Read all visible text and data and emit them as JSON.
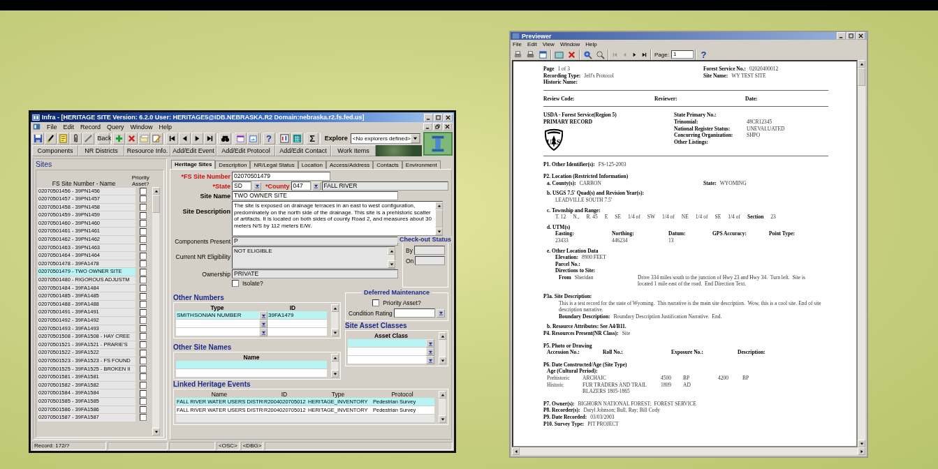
{
  "infra_window": {
    "title": "Infra - [HERITAGE SITE  Version: 6.2.0  User: HERITAGE5@IDB.NEBRASKA.R2  Domain:nebraska.r2.fs.fed.us]",
    "menu": [
      "File",
      "Edit",
      "Record",
      "Query",
      "Window",
      "Help"
    ],
    "toolbar": {
      "back": "Back",
      "help_glyph": "?",
      "sum_glyph": "Σ",
      "explore_label": "Explore",
      "explore_value": "<No explorers defined>"
    },
    "buttons": [
      "Components",
      "NR Districts",
      "Resource Info.",
      "Add/Edit Event",
      "Add/Edit Protocol",
      "Add/Edit Contact",
      "Work Items"
    ],
    "sites": {
      "title": "Sites",
      "columns": [
        "FS Site Number - Name",
        "Priority Asset?"
      ],
      "rows": [
        {
          "label": "02070501456 - 39PN1456",
          "priority": false,
          "selected": false
        },
        {
          "label": "02070501457 - 39PN1457",
          "priority": false,
          "selected": false
        },
        {
          "label": "02070501458 - 39PN1458",
          "priority": false,
          "selected": false
        },
        {
          "label": "02070501459 - 39PN1459",
          "priority": false,
          "selected": false
        },
        {
          "label": "02070501460 - 39PN1460",
          "priority": false,
          "selected": false
        },
        {
          "label": "02070501461 - 39PN1461",
          "priority": false,
          "selected": false
        },
        {
          "label": "02070501462 - 39PN1462",
          "priority": false,
          "selected": false
        },
        {
          "label": "02070501463 - 39PN1463",
          "priority": false,
          "selected": false
        },
        {
          "label": "02070501464 - 39PN1464",
          "priority": false,
          "selected": false
        },
        {
          "label": "02070501478 - 39FA1478",
          "priority": false,
          "selected": false
        },
        {
          "label": "02070501479 - TWO OWNER SITE",
          "priority": false,
          "selected": true
        },
        {
          "label": "02070501480 - RIGOROUS ADJUSTM",
          "priority": false,
          "selected": false
        },
        {
          "label": "02070501484 - 39FA1484",
          "priority": false,
          "selected": false
        },
        {
          "label": "02070501485 - 39FA1485",
          "priority": false,
          "selected": false
        },
        {
          "label": "02070501488 - 39FA1488",
          "priority": false,
          "selected": false
        },
        {
          "label": "02070501491 - 39FA1491",
          "priority": false,
          "selected": false
        },
        {
          "label": "02070501492 - 39FA1492",
          "priority": false,
          "selected": false
        },
        {
          "label": "02070501493 - 39FA1493",
          "priority": false,
          "selected": false
        },
        {
          "label": "02070501508 - 39FA1508 - HAY CREE",
          "priority": false,
          "selected": false
        },
        {
          "label": "02070501521 - 39FA1521 - PRARIE'S",
          "priority": false,
          "selected": false
        },
        {
          "label": "02070501522 - 39FA1522",
          "priority": false,
          "selected": false
        },
        {
          "label": "02070501523 - 39FA1523 - FS FOUND",
          "priority": false,
          "selected": false
        },
        {
          "label": "02070501525 - 39FA1525 - BROKEN II",
          "priority": false,
          "selected": false
        },
        {
          "label": "02070501581 - 39FA1581",
          "priority": false,
          "selected": false
        },
        {
          "label": "02070501582 - 39FA1582",
          "priority": false,
          "selected": false
        },
        {
          "label": "02070501584 - 39FA1584",
          "priority": false,
          "selected": false
        },
        {
          "label": "02070501585 - 39FA1585",
          "priority": false,
          "selected": false
        },
        {
          "label": "02070501586 - 39FA1586",
          "priority": false,
          "selected": false
        },
        {
          "label": "02070501587 - 39FA1587",
          "priority": false,
          "selected": false
        }
      ]
    },
    "tabs": [
      {
        "label": "Heritage Sites",
        "selected": true
      },
      {
        "label": "Description",
        "selected": false
      },
      {
        "label": "NR/Legal Status",
        "selected": false
      },
      {
        "label": "Location",
        "selected": false
      },
      {
        "label": "Access/Address",
        "selected": false
      },
      {
        "label": "Contacts",
        "selected": false
      },
      {
        "label": "Environment",
        "selected": false
      }
    ],
    "form": {
      "fs_site_number": {
        "label": "*FS Site Number",
        "value": "02070501479",
        "required": true,
        "key_field": true,
        "read_only": false
      },
      "state": {
        "label": "*State",
        "value": "SD",
        "required": true,
        "key_field": true,
        "read_only": false
      },
      "county": {
        "label": "*County",
        "value": "047",
        "required": true,
        "key_field": true,
        "read_only": false
      },
      "county_name": {
        "value": "FALL RIVER",
        "read_only": true
      },
      "site_name": {
        "label": "Site Name",
        "value": "TWO OWNER SITE",
        "required": false,
        "key_field": true,
        "read_only": false
      },
      "site_description": {
        "label": "Site Description",
        "value": "The site is exposed on drainage terraces in an east to west configuration, predominately on the north side of the drainage. This site is a prehistoric scatter of artifacts.  It is located on both sides of county Road 2, and measures about 30 meters N/S by 112 meters E/W.",
        "required": false,
        "key_field": true,
        "read_only": false
      },
      "components_present": {
        "label": "Components Present",
        "value": "P",
        "required": false,
        "key_field": false,
        "read_only": true
      },
      "current_nr_eligibility": {
        "label": "Current NR Eligibility",
        "value": "NOT ELIGIBLE",
        "required": false,
        "key_field": false,
        "read_only": true
      },
      "ownership": {
        "label": "Ownership",
        "value": "PRIVATE",
        "required": false,
        "key_field": false,
        "read_only": true
      },
      "isolate": {
        "label": "Isolate?",
        "checked": false
      }
    },
    "checkout_status": {
      "title": "Check-out Status",
      "fields": [
        "By",
        "On"
      ]
    },
    "deferred_maintenance": {
      "title": "Deferred Maintenance",
      "priority_asset": {
        "label": "Priority Asset?",
        "checked": false
      },
      "condition_rating": {
        "label": "Condition Rating"
      }
    },
    "other_numbers": {
      "title": "Other Numbers",
      "columns": [
        "Type",
        "ID"
      ],
      "rows": [
        {
          "type": "SMITHSONIAN NUMBER",
          "id": "39FA1479",
          "selected": true
        }
      ]
    },
    "site_asset_classes": {
      "title": "Site Asset Classes",
      "columns": [
        "Asset Class"
      ]
    },
    "other_site_names": {
      "title": "Other Site Names",
      "columns": [
        "Name"
      ]
    },
    "linked_heritage_events": {
      "title": "Linked Heritage Events",
      "columns": [
        "Name",
        "ID",
        "Type",
        "Protocol"
      ],
      "rows": [
        {
          "name": "FALL RIVER WATER USERS DISTRI",
          "id": "R2004020705012",
          "type": "HERITAGE_INVENTORY",
          "protocol": "Pedestrian Survey",
          "selected": true
        },
        {
          "name": "FALL RIVER WATER USERS DISTRI",
          "id": "R2004020705012",
          "type": "HERITAGE_INVENTORY",
          "protocol": "Pedestrian Survey",
          "selected": false
        }
      ]
    },
    "status_bar": [
      "Record: 172/?",
      "<OSC>",
      "<DBG>"
    ]
  },
  "previewer_window": {
    "title": "Previewer",
    "menu": [
      "File",
      "Edit",
      "View",
      "Window",
      "Help"
    ],
    "toolbar": {
      "page_label": "Page:",
      "page_value": "1",
      "help_glyph": "?"
    },
    "report": {
      "lines": [
        {
          "kind": "pair",
          "cells": [
            {
              "label": "Page",
              "value": "1 of 3"
            },
            {
              "label": "Forest Service No.:",
              "value": "02020400012"
            }
          ]
        },
        {
          "kind": "pair",
          "cells": [
            {
              "label": "Recording Type:",
              "value": "Jeff's Protocol"
            },
            {
              "label": "Site Name:",
              "value": "WY TEST SITE"
            }
          ]
        },
        {
          "kind": "single",
          "cells": [
            {
              "label": "Historic Name:"
            }
          ]
        },
        {
          "kind": "rule"
        },
        {
          "kind": "cols3",
          "cells": [
            {
              "label": "Review Code:"
            },
            {
              "label": "Reviewer:"
            },
            {
              "label": "Date:"
            }
          ]
        },
        {
          "kind": "rule"
        },
        {
          "kind": "agency",
          "left": [
            "USDA - Forest Service(Region 5)",
            "PRIMARY RECORD"
          ],
          "logo_letters": [
            "U",
            "S"
          ],
          "cells": [
            {
              "label": "State Primary No.:"
            },
            {
              "label": "Trinomial:",
              "value": "48CR12345"
            },
            {
              "label": "National Register Status:",
              "value": "UNEVALUATED"
            },
            {
              "label": "Concurring Organization:",
              "value": "SHPO"
            },
            {
              "label": "Other Listings:"
            }
          ]
        },
        {
          "kind": "rule"
        },
        {
          "kind": "single",
          "cells": [
            {
              "label": "P1. Other Identifier(s):",
              "value": "FS-125-2003"
            }
          ]
        },
        {
          "kind": "section",
          "cells": [
            {
              "label": "P2. Location (Restricted Information)"
            }
          ]
        },
        {
          "kind": "pair-sub",
          "cells": [
            {
              "label": "a. County(s):",
              "value": "CARBON"
            },
            {
              "label": "State:",
              "value": "WYOMING"
            }
          ]
        },
        {
          "kind": "item",
          "cells": [
            {
              "label": "b. USGS 7.5' Quad(s) and Revision Year(s):"
            }
          ]
        },
        {
          "kind": "detail",
          "cells": [
            {
              "value": "LEADVILLE SOUTH 7.5'"
            }
          ]
        },
        {
          "kind": "item",
          "cells": [
            {
              "label": "c. Township and Range:"
            }
          ]
        },
        {
          "kind": "spread",
          "cells": [
            {
              "value": "T. 12"
            },
            {
              "value": "N.,"
            },
            {
              "value": "R. 45"
            },
            {
              "value": "E"
            },
            {
              "value": "SE"
            },
            {
              "value": "1/4 of"
            },
            {
              "value": "SW"
            },
            {
              "value": "1/4 of"
            },
            {
              "value": "NE"
            },
            {
              "value": "1/4 of"
            },
            {
              "value": "SE"
            },
            {
              "value": "1/4 of"
            },
            {
              "label": "Section"
            },
            {
              "value": "23"
            }
          ]
        },
        {
          "kind": "item",
          "cells": [
            {
              "label": "d. UTM(s)"
            }
          ]
        },
        {
          "kind": "cols5",
          "cells": [
            {
              "label": "Easting:"
            },
            {
              "label": "Northing:"
            },
            {
              "label": "Datum:"
            },
            {
              "label": "GPS Accuracy:"
            },
            {
              "label": "Point Type:"
            }
          ]
        },
        {
          "kind": "cols5",
          "cells": [
            {
              "value": "23433"
            },
            {
              "value": "446234"
            },
            {
              "value": "13"
            }
          ]
        },
        {
          "kind": "item",
          "cells": [
            {
              "label": "e. Other Location Data"
            }
          ]
        },
        {
          "kind": "detail",
          "cells": [
            {
              "label": "Elevation:",
              "value": "8900 FEET"
            }
          ]
        },
        {
          "kind": "detail",
          "cells": [
            {
              "label": "Parcel No.:"
            }
          ]
        },
        {
          "kind": "detail",
          "cells": [
            {
              "label": "Directions to Site:"
            }
          ]
        },
        {
          "kind": "direction",
          "cells": [
            {
              "label": "From",
              "value": "Sheridan"
            },
            {
              "value": "Drive 334 miles south to the junction of Hwy 23 and Hwy 34.  Turn left.  Site is located 1 mile east of the road.  End Direction Text."
            }
          ]
        },
        {
          "kind": "section",
          "cells": [
            {
              "label": "P3a. Site Description:"
            }
          ]
        },
        {
          "kind": "text",
          "cells": [
            {
              "value": "This is a test record for the state of Wyoming.  This narrative is the main site description.  Wow, this is a cool site. End of site description narrative."
            }
          ]
        },
        {
          "kind": "text",
          "cells": [
            {
              "label": "Boundary Description:",
              "value": "Boundary Description Justification Narrative.  End."
            }
          ]
        },
        {
          "kind": "item",
          "cells": [
            {
              "label": "b. Resource Attributes: See A4/B11."
            }
          ]
        },
        {
          "kind": "single",
          "cells": [
            {
              "label": "P4. Resources Present(NR Class):",
              "value": "Site"
            }
          ]
        },
        {
          "kind": "section",
          "cells": [
            {
              "label": "P5. Photo or Drawing"
            }
          ]
        },
        {
          "kind": "cols4",
          "cells": [
            {
              "label": "Accession No.:"
            },
            {
              "label": "Roll No.:"
            },
            {
              "label": "Exposure No.:"
            },
            {
              "label": "Description:"
            }
          ]
        },
        {
          "kind": "section",
          "cells": [
            {
              "label": "P6. Date Constructed/Age (Site Type)"
            }
          ]
        },
        {
          "kind": "sub",
          "cells": [
            {
              "label": "Age (Cultural Period):"
            }
          ]
        },
        {
          "kind": "age",
          "cells": [
            {
              "value": "Prehistoric"
            },
            {
              "value": "ARCHAIC"
            },
            {
              "value": "4500"
            },
            {
              "value": "BP"
            },
            {
              "value": "4200"
            },
            {
              "value": "BP"
            }
          ]
        },
        {
          "kind": "age",
          "cells": [
            {
              "value": "Historic"
            },
            {
              "value": "FUR TRADERS AND TRAIL BLAZERS 1805-1865"
            },
            {
              "value": "1809"
            },
            {
              "value": "AD"
            }
          ]
        },
        {
          "kind": "section",
          "cells": [
            {
              "label": "P7. Owner(s):",
              "value": "BIGHORN NATIONAL FOREST;  FOREST SERVICE"
            }
          ]
        },
        {
          "kind": "single",
          "cells": [
            {
              "label": "P8. Recorder(s):",
              "value": "Daryl Johnson; Bull, Ray; Bill Cody"
            }
          ]
        },
        {
          "kind": "single",
          "cells": [
            {
              "label": "P9. Date Recorded:",
              "value": "03/03/2003"
            }
          ]
        },
        {
          "kind": "single",
          "cells": [
            {
              "label": "P10. Survey Type:",
              "value": "PIT PROJECT"
            }
          ]
        }
      ]
    }
  }
}
